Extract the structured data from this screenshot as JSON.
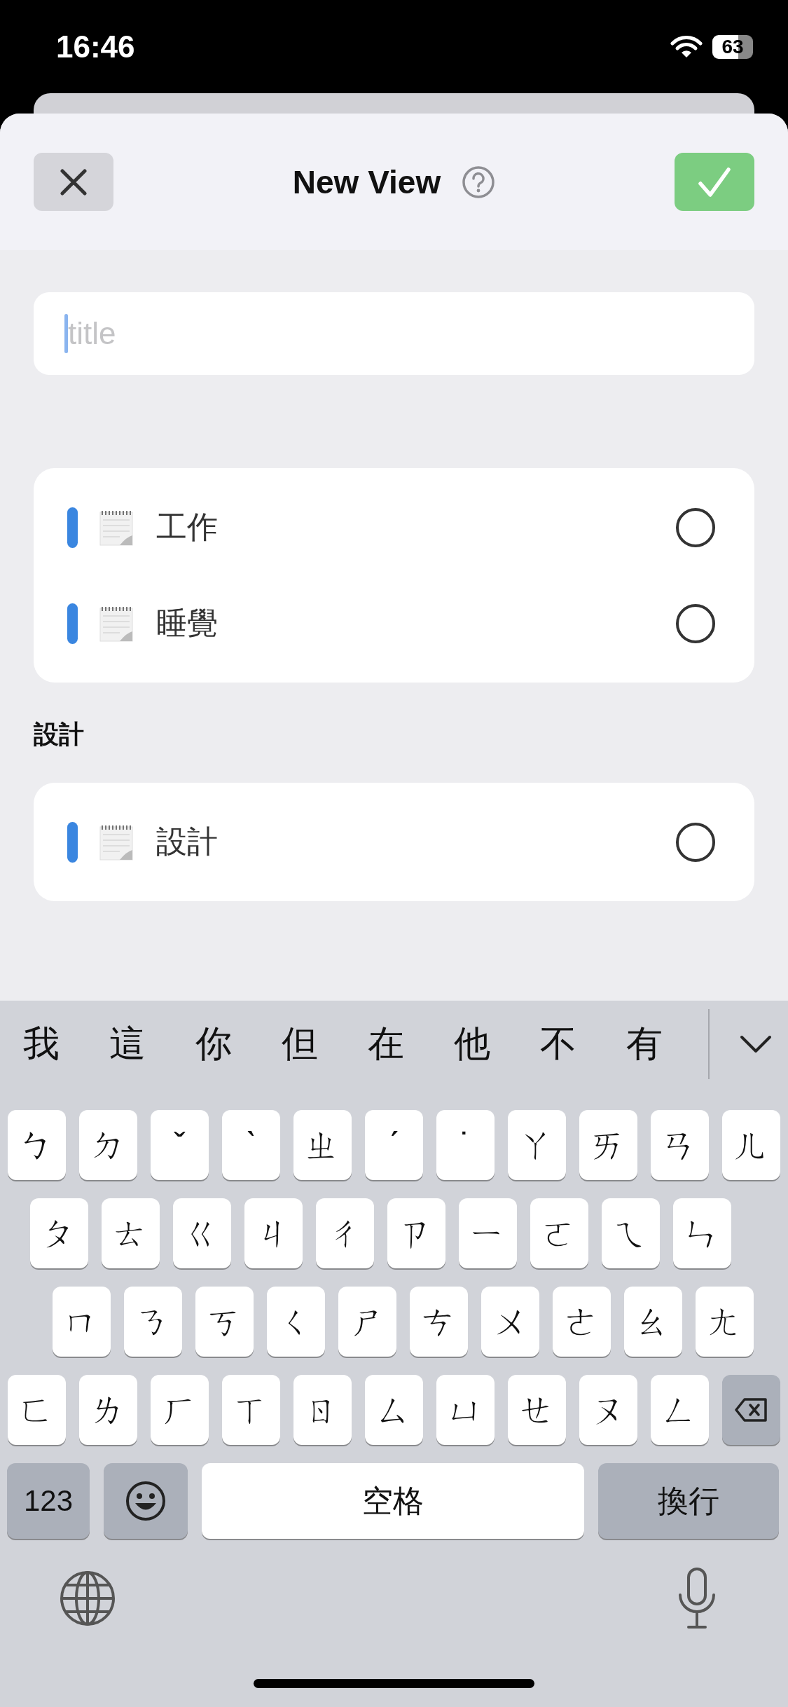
{
  "status_bar": {
    "time": "16:46",
    "battery": "63"
  },
  "header": {
    "title": "New View"
  },
  "title_field": {
    "placeholder": "title"
  },
  "groups": [
    {
      "items": [
        {
          "label": "工作",
          "color": "#3a86e0",
          "selected": false
        },
        {
          "label": "睡覺",
          "color": "#3a86e0",
          "selected": false
        }
      ]
    },
    {
      "heading": "設計",
      "items": [
        {
          "label": "設計",
          "color": "#3a86e0",
          "selected": false
        }
      ]
    }
  ],
  "keyboard": {
    "candidates": [
      "我",
      "這",
      "你",
      "但",
      "在",
      "他",
      "不",
      "有"
    ],
    "rows": [
      [
        "ㄅ",
        "ㄉ",
        "ˇ",
        "ˋ",
        "ㄓ",
        "ˊ",
        "˙",
        "ㄚ",
        "ㄞ",
        "ㄢ",
        "ㄦ"
      ],
      [
        "ㄆ",
        "ㄊ",
        "ㄍ",
        "ㄐ",
        "ㄔ",
        "ㄗ",
        "ㄧ",
        "ㄛ",
        "ㄟ",
        "ㄣ"
      ],
      [
        "ㄇ",
        "ㄋ",
        "ㄎ",
        "ㄑ",
        "ㄕ",
        "ㄘ",
        "ㄨ",
        "ㄜ",
        "ㄠ",
        "ㄤ"
      ],
      [
        "ㄈ",
        "ㄌ",
        "ㄏ",
        "ㄒ",
        "ㄖ",
        "ㄙ",
        "ㄩ",
        "ㄝ",
        "ㄡ",
        "ㄥ"
      ]
    ],
    "numbers_key": "123",
    "space_key": "空格",
    "return_key": "換行"
  }
}
